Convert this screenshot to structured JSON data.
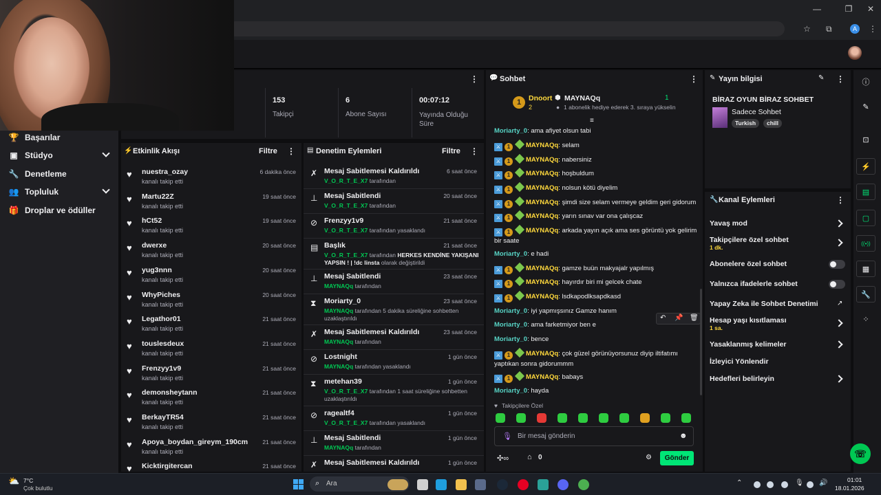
{
  "browser": {
    "window_controls": [
      "—",
      "❐",
      "✕"
    ],
    "profile_initial": "A"
  },
  "nav": {
    "items": [
      {
        "label": "Başarılar",
        "icon": "trophy-icon",
        "chevron": false
      },
      {
        "label": "Stüdyo",
        "icon": "camera-icon",
        "chevron": true
      },
      {
        "label": "Denetleme",
        "icon": "wrench-icon",
        "chevron": false
      },
      {
        "label": "Topluluk",
        "icon": "people-icon",
        "chevron": true
      },
      {
        "label": "Droplar ve ödüller",
        "icon": "gift-icon",
        "chevron": false
      }
    ]
  },
  "stats": [
    {
      "value": "153",
      "label": "Takipçi"
    },
    {
      "value": "6",
      "label": "Abone Sayısı"
    },
    {
      "value": "00:07:12",
      "label": "Yayında Olduğu Süre"
    }
  ],
  "activity": {
    "title": "Etkinlik Akışı",
    "filter": "Filtre",
    "items": [
      {
        "name": "nuestra_ozay",
        "action": "kanalı takip etti",
        "time": "6 dakika önce"
      },
      {
        "name": "Martu22Z",
        "action": "kanalı takip etti",
        "time": "19 saat önce"
      },
      {
        "name": "hCt52",
        "action": "kanalı takip etti",
        "time": "19 saat önce"
      },
      {
        "name": "dwerxe",
        "action": "kanalı takip etti",
        "time": "20 saat önce"
      },
      {
        "name": "yug3nnn",
        "action": "kanalı takip etti",
        "time": "20 saat önce"
      },
      {
        "name": "WhyPiches",
        "action": "kanalı takip etti",
        "time": "20 saat önce"
      },
      {
        "name": "Legathor01",
        "action": "kanalı takip etti",
        "time": "21 saat önce"
      },
      {
        "name": "touslesdeux",
        "action": "kanalı takip etti",
        "time": "21 saat önce"
      },
      {
        "name": "Frenzyy1v9",
        "action": "kanalı takip etti",
        "time": "21 saat önce"
      },
      {
        "name": "demonsheytann",
        "action": "kanalı takip etti",
        "time": "21 saat önce"
      },
      {
        "name": "BerkayTR54",
        "action": "kanalı takip etti",
        "time": "21 saat önce"
      },
      {
        "name": "Apoya_boydan_gireym_190cm",
        "action": "kanalı takip etti",
        "time": "21 saat önce"
      },
      {
        "name": "Kicktirgitercan",
        "action": "",
        "time": "21 saat önce"
      }
    ]
  },
  "moderation": {
    "title": "Denetim Eylemleri",
    "filter": "Filtre",
    "items": [
      {
        "icon": "unpin-icon",
        "title": "Mesaj Sabitlemesi Kaldırıldı",
        "user": "V_O_R_T_E_X7",
        "rest": "tarafından",
        "time": "6 saat önce"
      },
      {
        "icon": "pin-icon",
        "title": "Mesaj Sabitlendi",
        "user": "V_O_R_T_E_X7",
        "rest": "tarafından",
        "time": "20 saat önce"
      },
      {
        "icon": "ban-icon",
        "title": "Frenzyy1v9",
        "user": "V_O_R_T_E_X7",
        "rest": "tarafından yasaklandı",
        "time": "21 saat önce"
      },
      {
        "icon": "title-icon",
        "title": "Başlık",
        "user": "V_O_R_T_E_X7",
        "rest": "tarafından",
        "bold": "HERKES KENDİNE YAKIŞANI YAPSIN ! | !dc linsta",
        "rest2": "olarak değiştirildi",
        "time": "21 saat önce"
      },
      {
        "icon": "pin-icon",
        "title": "Mesaj Sabitlendi",
        "user": "MAYNAQq",
        "rest": "tarafından",
        "time": "23 saat önce"
      },
      {
        "icon": "timeout-icon",
        "title": "Moriarty_0",
        "user": "MAYNAQq",
        "rest": "tarafından 5 dakika süreliğine sohbetten uzaklaştırıldı",
        "time": "23 saat önce"
      },
      {
        "icon": "unpin-icon",
        "title": "Mesaj Sabitlemesi Kaldırıldı",
        "user": "MAYNAQq",
        "rest": "tarafından",
        "time": "23 saat önce"
      },
      {
        "icon": "ban-icon",
        "title": "Lostnight",
        "user": "MAYNAQq",
        "rest": "tarafından yasaklandı",
        "time": "1 gün önce"
      },
      {
        "icon": "timeout-icon",
        "title": "metehan39",
        "user": "V_O_R_T_E_X7",
        "rest": "tarafından 1 saat süreliğine sohbetten uzaklaştırıldı",
        "time": "1 gün önce"
      },
      {
        "icon": "ban-icon",
        "title": "ragealtf4",
        "user": "V_O_R_T_E_X7",
        "rest": "tarafından yasaklandı",
        "time": "1 gün önce"
      },
      {
        "icon": "pin-icon",
        "title": "Mesaj Sabitlendi",
        "user": "MAYNAQq",
        "rest": "tarafından",
        "time": "1 gün önce"
      },
      {
        "icon": "unpin-icon",
        "title": "Mesaj Sabitlemesi Kaldırıldı",
        "user": "",
        "rest": "",
        "time": "1 gün önce"
      }
    ]
  },
  "chat": {
    "title": "Sohbet",
    "leaderboard": {
      "rank": "1",
      "top_user": "Dnoort",
      "top_count": "2",
      "gifter": "MAYNAQq",
      "gifter_count": "1",
      "gift_text": "1 abonelik hediye ederek 3. sıraya yükselin"
    },
    "messages": [
      {
        "user": "Moriarty_0",
        "type": "mor",
        "text": "ama afiyet olsun tabi"
      },
      {
        "user": "MAYNAQq",
        "type": "may",
        "text": "selam"
      },
      {
        "user": "MAYNAQq",
        "type": "may",
        "text": "nabersiniz"
      },
      {
        "user": "MAYNAQq",
        "type": "may",
        "text": "hoşbuldum"
      },
      {
        "user": "MAYNAQq",
        "type": "may",
        "text": "nolsun kötü diyelim"
      },
      {
        "user": "MAYNAQq",
        "type": "may",
        "text": "şimdi size selam vermeye geldim geri gidorum"
      },
      {
        "user": "MAYNAQq",
        "type": "may",
        "text": "yarın sınav var ona çalışcaz"
      },
      {
        "user": "MAYNAQq",
        "type": "may",
        "text": "arkada yayın açık ama ses görüntü yok gelirim bir saate"
      },
      {
        "user": "Moriarty_0",
        "type": "mor",
        "text": "e hadi"
      },
      {
        "user": "MAYNAQq",
        "type": "may",
        "text": "gamze buün makyajalr yapılmış"
      },
      {
        "user": "MAYNAQq",
        "type": "may",
        "text": "hayırdır biri mi gelcek chate"
      },
      {
        "user": "MAYNAQq",
        "type": "may",
        "text": "lsdkapodlksapdkasd"
      },
      {
        "user": "Moriarty_0",
        "type": "mor",
        "text": "iyi yapmışsınız Gamze hanım"
      },
      {
        "user": "Moriarty_0",
        "type": "mor",
        "text": "ama farketmiyor ben e"
      },
      {
        "user": "Moriarty_0",
        "type": "mor",
        "text": "bence"
      },
      {
        "user": "MAYNAQq",
        "type": "may",
        "text": "çok güzel görünüyorsunuz diyip iltifatımı yaptıkan sonra gidorummm"
      },
      {
        "user": "MAYNAQq",
        "type": "may",
        "text": "babays"
      },
      {
        "user": "Moriarty_0",
        "type": "mor",
        "text": "hayda"
      }
    ],
    "followers_only": "Takipçilere Özel",
    "placeholder": "Bir mesaj gönderin",
    "points": "0",
    "send": "Gönder"
  },
  "stream_info": {
    "title": "Yayın bilgisi",
    "stream_title": "BİRAZ OYUN BİRAZ SOHBET",
    "category": "Sadece Sohbet",
    "tags": [
      "Turkish",
      "chill"
    ]
  },
  "channel_actions": {
    "title": "Kanal Eylemleri",
    "items": [
      {
        "label": "Yavaş mod",
        "sub": "",
        "control": "chevron"
      },
      {
        "label": "Takipçilere özel sohbet",
        "sub": "1 dk.",
        "control": "chevron"
      },
      {
        "label": "Abonelere özel sohbet",
        "sub": "",
        "control": "toggle"
      },
      {
        "label": "Yalnızca ifadelerle sohbet",
        "sub": "",
        "control": "toggle"
      },
      {
        "label": "Yapay Zeka ile Sohbet Denetimi",
        "sub": "",
        "control": "external"
      },
      {
        "label": "Hesap yaşı kısıtlaması",
        "sub": "1 sa.",
        "control": "chevron"
      },
      {
        "label": "Yasaklanmış kelimeler",
        "sub": "",
        "control": "chevron"
      },
      {
        "label": "İzleyici Yönlendir",
        "sub": "",
        "control": "none"
      },
      {
        "label": "Hedefleri belirleyin",
        "sub": "",
        "control": "chevron"
      }
    ]
  },
  "taskbar": {
    "weather_temp": "7°C",
    "weather_desc": "Çok bulutlu",
    "search": "Ara",
    "time": "01:01",
    "date": "18.01.2026"
  },
  "colors": {
    "accent_green": "#00e676",
    "mod_yellow": "#ffd93d",
    "mor_teal": "#58d4c6",
    "panel": "#18181b"
  }
}
